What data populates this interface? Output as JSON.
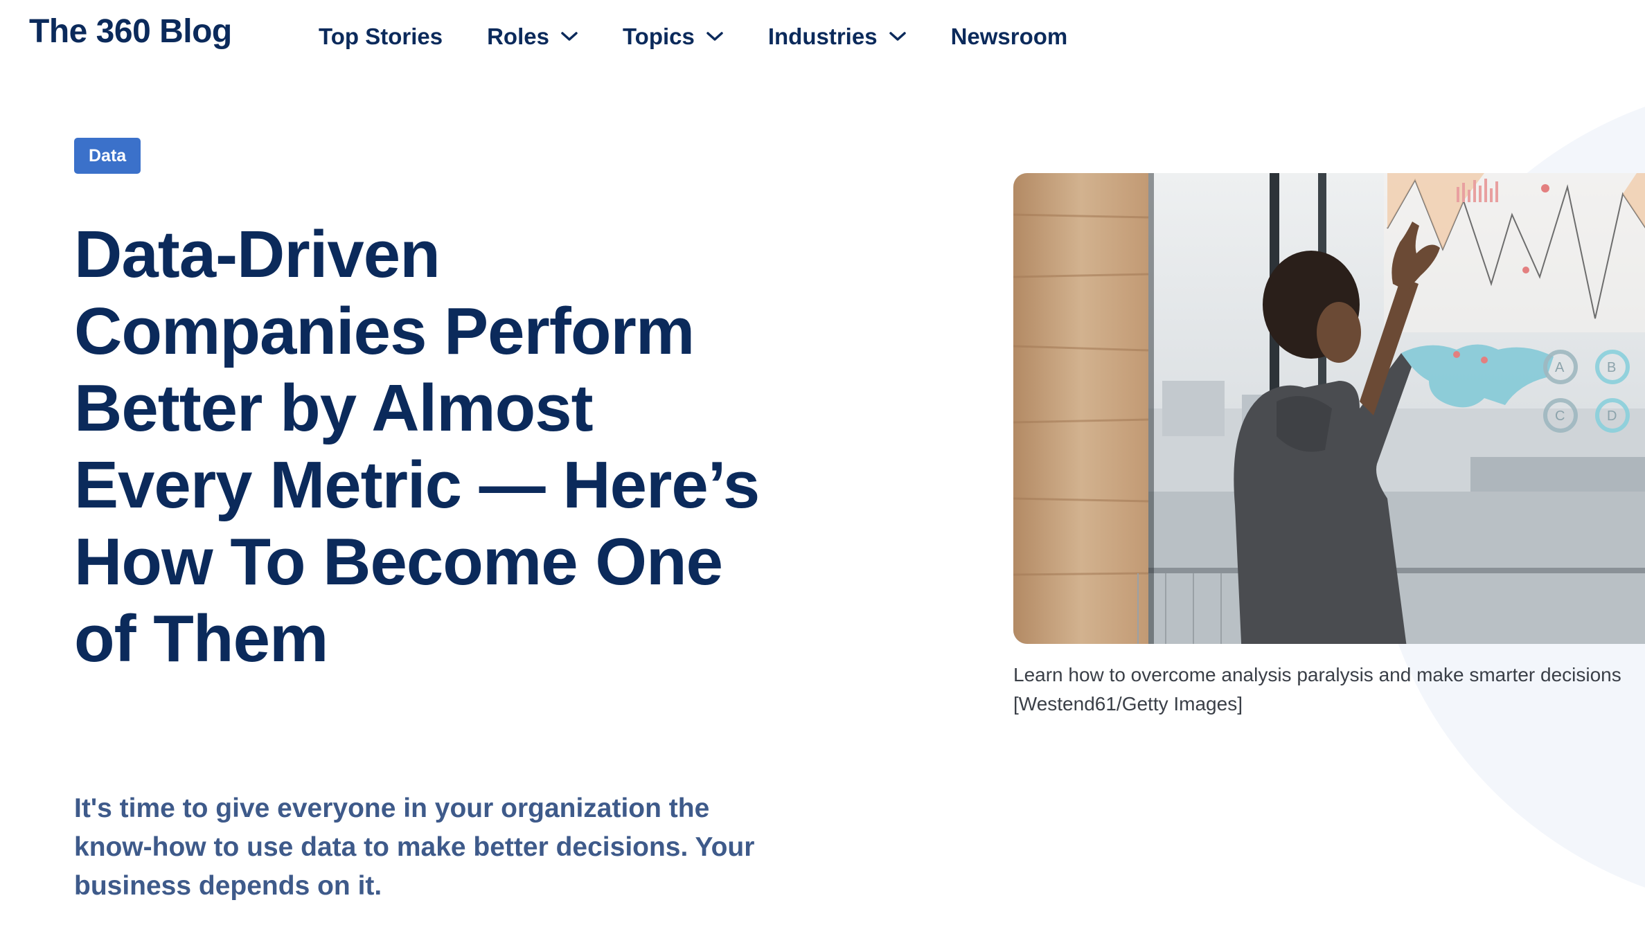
{
  "header": {
    "logo": "The 360 Blog",
    "nav": [
      {
        "label": "Top Stories",
        "has_dropdown": false
      },
      {
        "label": "Roles",
        "has_dropdown": true
      },
      {
        "label": "Topics",
        "has_dropdown": true
      },
      {
        "label": "Industries",
        "has_dropdown": true
      },
      {
        "label": "Newsroom",
        "has_dropdown": false
      }
    ]
  },
  "article": {
    "category": "Data",
    "title": "Data-Driven Companies Perform Better by Almost Every Metric — Here’s How To Become One of Them",
    "subtitle": "It's time to give everyone in your organization the know-how to use data to make better decisions. Your business depends on it.",
    "image": {
      "icon": "woman-at-data-wall-photo",
      "caption": "Learn how to overcome analysis paralysis and make smarter decisions",
      "credit": "[Westend61/Getty Images]"
    }
  },
  "colors": {
    "brand_navy": "#0b2a5b",
    "badge_blue": "#3b71ca",
    "subtitle": "#3e5a8a",
    "caption": "#3a3f47"
  }
}
